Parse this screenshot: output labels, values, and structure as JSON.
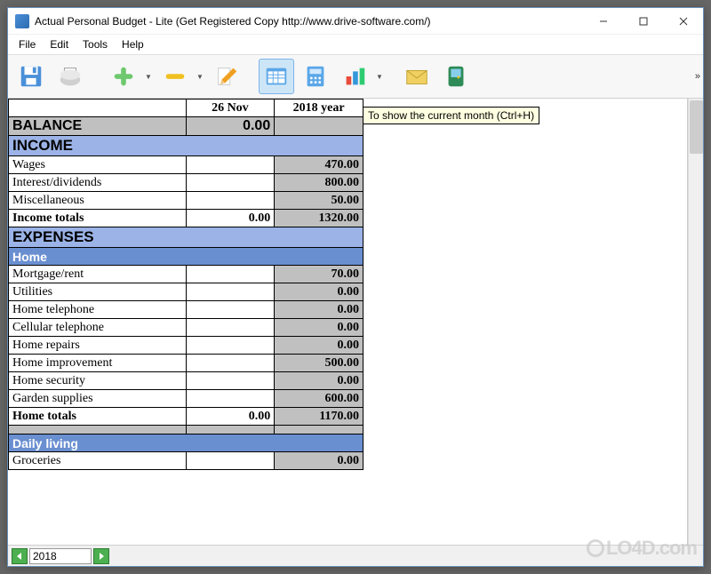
{
  "window": {
    "title": "Actual Personal Budget - Lite (Get Registered Copy http://www.drive-software.com/)"
  },
  "menu": {
    "file": "File",
    "edit": "Edit",
    "tools": "Tools",
    "help": "Help"
  },
  "tooltip": "To show the current month (Ctrl+H)",
  "columns": {
    "date": "26 Nov",
    "year": "2018 year"
  },
  "balance": {
    "label": "BALANCE",
    "date_val": "0.00",
    "year_val": ""
  },
  "income": {
    "header": "INCOME",
    "rows": [
      {
        "label": "Wages",
        "date_val": "",
        "year_val": "470.00"
      },
      {
        "label": "Interest/dividends",
        "date_val": "",
        "year_val": "800.00"
      },
      {
        "label": "Miscellaneous",
        "date_val": "",
        "year_val": "50.00"
      }
    ],
    "total": {
      "label": "Income totals",
      "date_val": "0.00",
      "year_val": "1320.00"
    }
  },
  "expenses": {
    "header": "EXPENSES",
    "home": {
      "header": "Home",
      "rows": [
        {
          "label": "Mortgage/rent",
          "date_val": "",
          "year_val": "70.00"
        },
        {
          "label": "Utilities",
          "date_val": "",
          "year_val": "0.00"
        },
        {
          "label": "Home telephone",
          "date_val": "",
          "year_val": "0.00"
        },
        {
          "label": "Cellular telephone",
          "date_val": "",
          "year_val": "0.00"
        },
        {
          "label": "Home repairs",
          "date_val": "",
          "year_val": "0.00"
        },
        {
          "label": "Home improvement",
          "date_val": "",
          "year_val": "500.00"
        },
        {
          "label": "Home security",
          "date_val": "",
          "year_val": "0.00"
        },
        {
          "label": "Garden supplies",
          "date_val": "",
          "year_val": "600.00"
        }
      ],
      "total": {
        "label": "Home totals",
        "date_val": "0.00",
        "year_val": "1170.00"
      }
    },
    "daily": {
      "header": "Daily living",
      "rows": [
        {
          "label": "Groceries",
          "date_val": "",
          "year_val": "0.00"
        }
      ]
    }
  },
  "status": {
    "year": "2018"
  },
  "watermark": "LO4D.com"
}
